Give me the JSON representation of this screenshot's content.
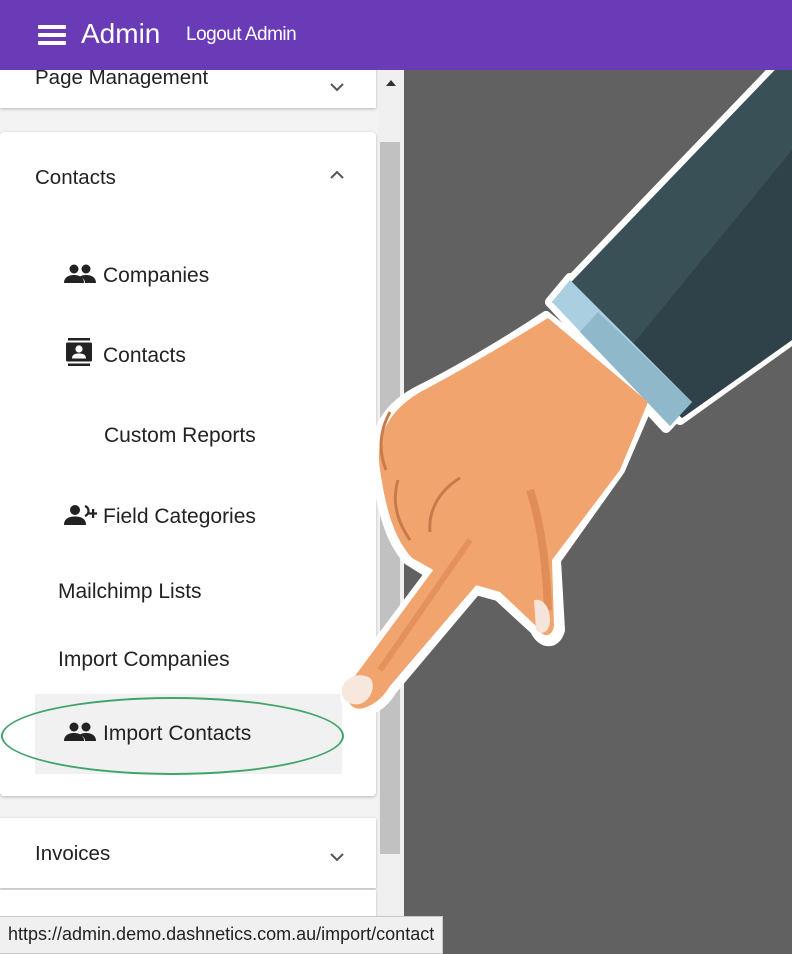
{
  "header": {
    "menu_icon": "hamburger-icon",
    "title": "Admin",
    "logout_label": "Logout Admin"
  },
  "sidebar": {
    "page_management": {
      "label": "Page Management",
      "icon": "chevron-down-icon"
    },
    "contacts_panel": {
      "label": "Contacts",
      "icon": "chevron-up-icon",
      "items": [
        {
          "label": "Companies",
          "icon": "people-icon"
        },
        {
          "label": "Contacts",
          "icon": "contact-book-icon"
        },
        {
          "label": "Custom Reports",
          "icon": ""
        },
        {
          "label": "Field Categories",
          "icon": "person-add-icon"
        },
        {
          "label": "Mailchimp Lists",
          "icon": ""
        },
        {
          "label": "Import Companies",
          "icon": ""
        },
        {
          "label": "Import Contacts",
          "icon": "people-icon",
          "active": true
        }
      ]
    },
    "invoices": {
      "label": "Invoices",
      "icon": "chevron-down-icon"
    }
  },
  "status_bar": {
    "url": "https://admin.demo.dashnetics.com.au/import/contact"
  },
  "colors": {
    "header_bg": "#6a3bb7",
    "backdrop": "#616161",
    "highlight_ring": "#3fa56a"
  }
}
